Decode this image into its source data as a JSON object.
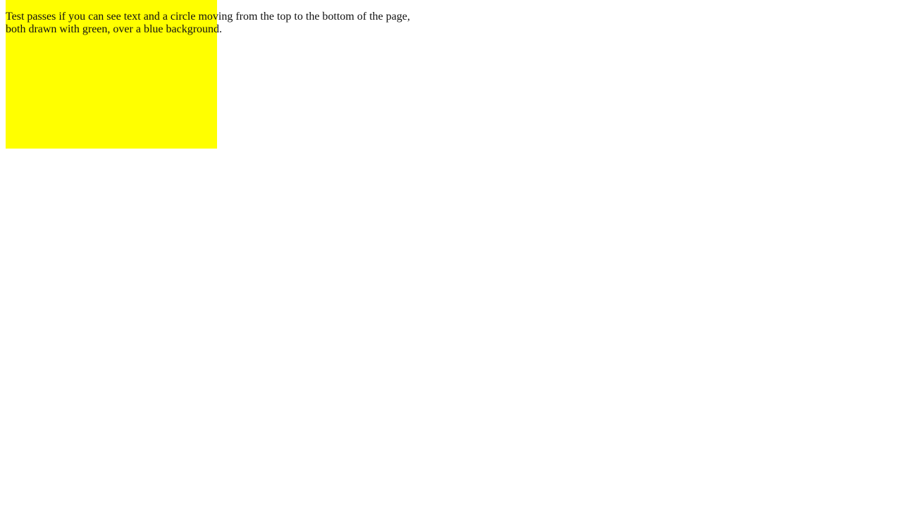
{
  "test": {
    "description": "Test passes if you can see text and a circle moving from the top to the bottom of the page, both drawn with green, over a blue background."
  },
  "colors": {
    "box_fill": "#ffff00",
    "text": "#111111",
    "page_background": "#ffffff"
  }
}
